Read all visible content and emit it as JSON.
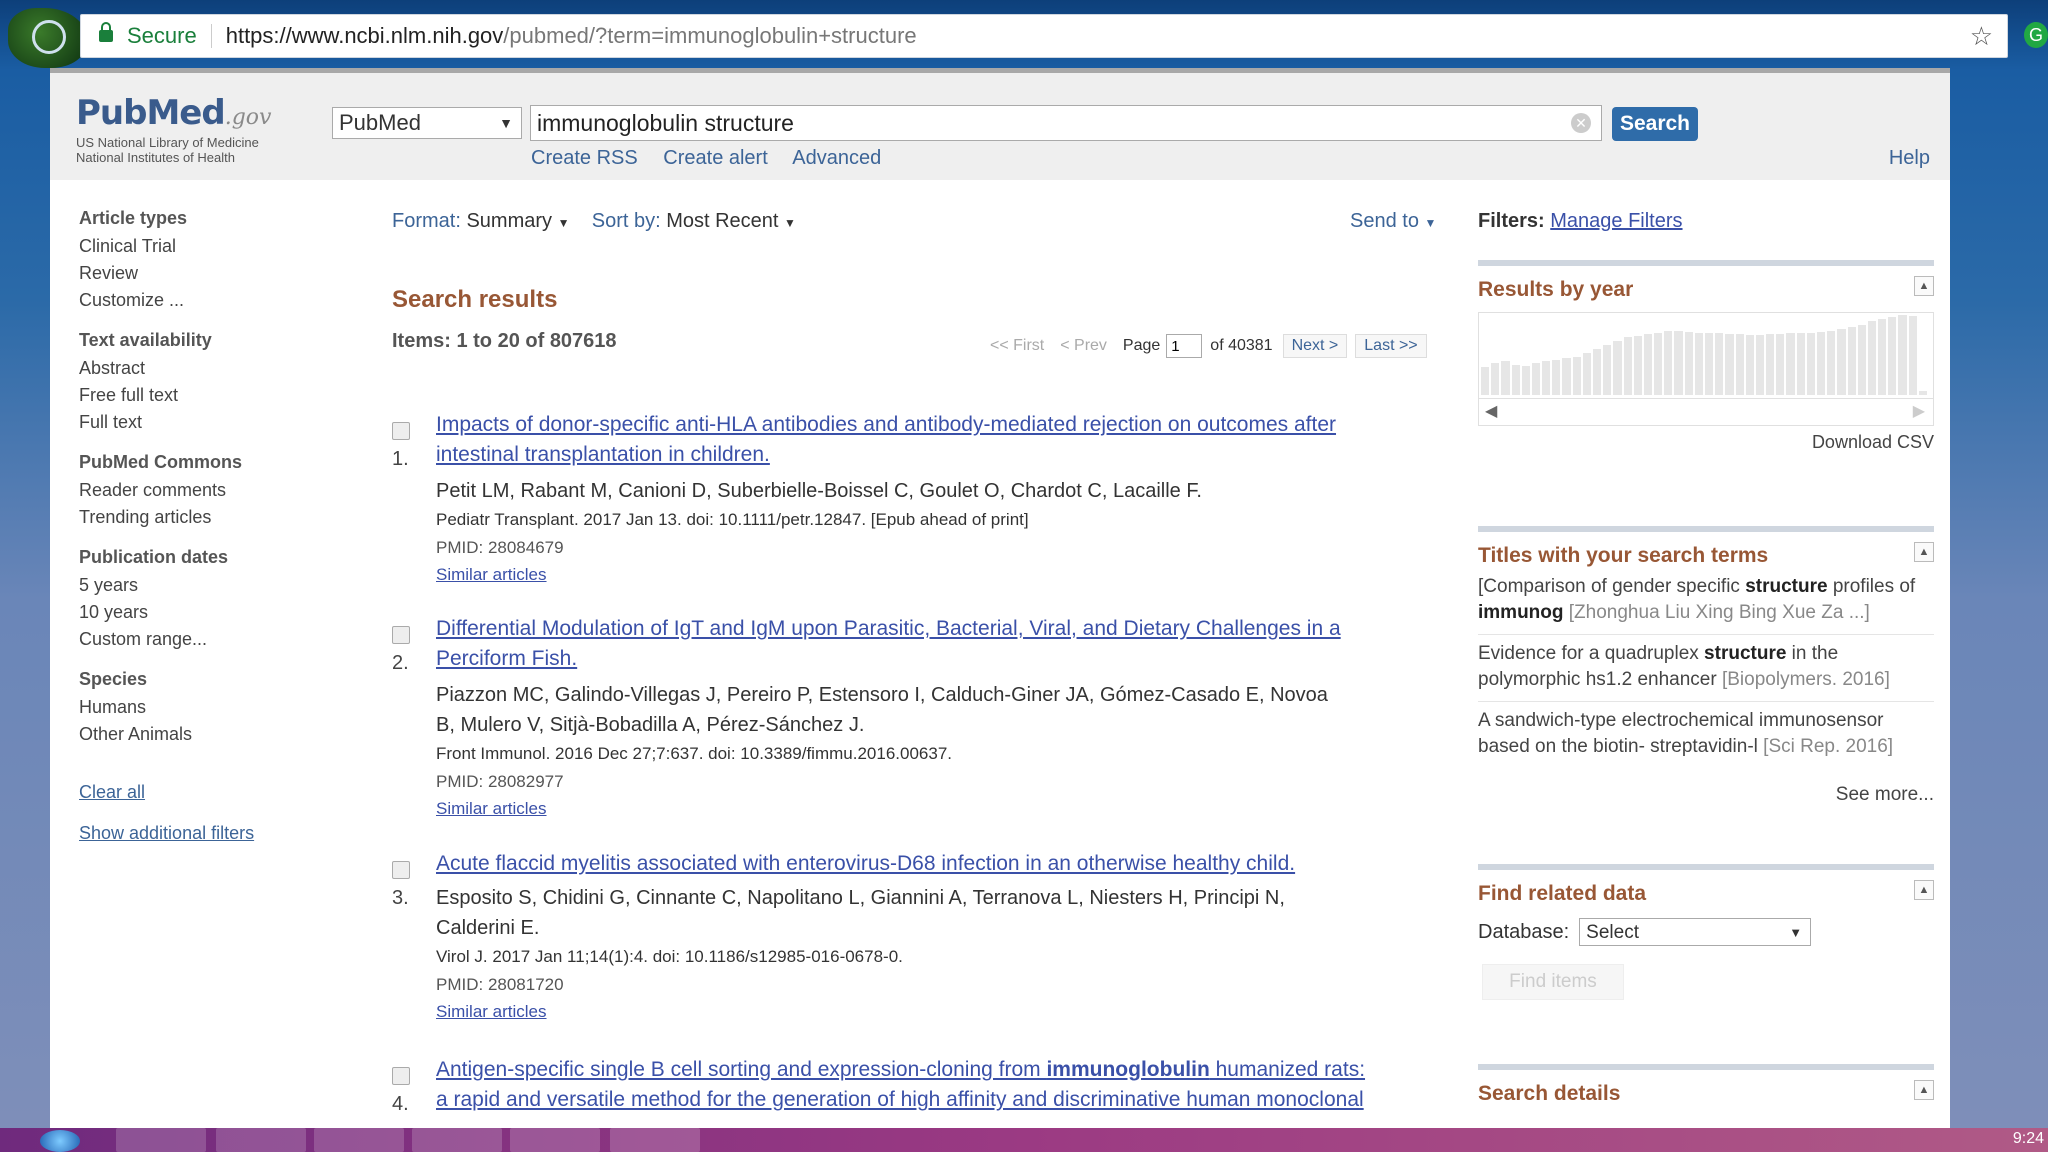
{
  "browser": {
    "secure_label": "Secure",
    "url_host": "https://www.ncbi.nlm.nih.gov",
    "url_path": "/pubmed/?term=immunoglobulin+structure"
  },
  "header": {
    "logo_main": "PubMed",
    "logo_gov": ".gov",
    "logo_sub1": "US National Library of Medicine",
    "logo_sub2": "National Institutes of Health",
    "db_selected": "PubMed",
    "search_value": "immunoglobulin structure",
    "search_button": "Search",
    "links": [
      "Create RSS",
      "Create alert",
      "Advanced"
    ],
    "help": "Help"
  },
  "sidebar": {
    "groups": [
      {
        "head": "Article types",
        "items": [
          "Clinical Trial",
          "Review",
          "Customize ..."
        ]
      },
      {
        "head": "Text availability",
        "items": [
          "Abstract",
          "Free full text",
          "Full text"
        ]
      },
      {
        "head": "PubMed Commons",
        "items": [
          "Reader comments",
          "Trending articles"
        ]
      },
      {
        "head": "Publication dates",
        "items": [
          "5 years",
          "10 years",
          "Custom range..."
        ]
      },
      {
        "head": "Species",
        "items": [
          "Humans",
          "Other Animals"
        ]
      }
    ],
    "clear_all": "Clear all",
    "show_filters": "Show additional filters"
  },
  "toolbar": {
    "format_label": "Format:",
    "format_value": "Summary",
    "sort_label": "Sort by:",
    "sort_value": "Most Recent",
    "send_to": "Send to"
  },
  "results": {
    "title": "Search results",
    "count": "Items: 1 to 20 of 807618",
    "pager": {
      "first": "<< First",
      "prev": "< Prev",
      "page_label": "Page",
      "page_value": "1",
      "of": "of 40381",
      "next": "Next >",
      "last": "Last >>"
    },
    "items": [
      {
        "num": "1.",
        "title_line1": "Impacts of donor-specific anti-HLA antibodies and antibody-mediated rejection on outcomes after",
        "title_line2": "intestinal transplantation in children.",
        "authors": "Petit LM, Rabant M, Canioni D, Suberbielle-Boissel C, Goulet O, Chardot C, Lacaille F.",
        "journal": "Pediatr Transplant. 2017 Jan 13. doi: 10.1111/petr.12847. [Epub ahead of print]",
        "pmid": "PMID: 28084679",
        "similar": "Similar articles"
      },
      {
        "num": "2.",
        "title_line1": "Differential Modulation of IgT and IgM upon Parasitic, Bacterial, Viral, and Dietary Challenges in a",
        "title_line2": "Perciform Fish.",
        "authors_line1": "Piazzon MC, Galindo-Villegas J, Pereiro P, Estensoro I, Calduch-Giner JA, Gómez-Casado E, Novoa",
        "authors_line2": "B, Mulero V, Sitjà-Bobadilla A, Pérez-Sánchez J.",
        "journal": "Front Immunol. 2016 Dec 27;7:637. doi: 10.3389/fimmu.2016.00637.",
        "pmid": "PMID: 28082977",
        "similar": "Similar articles"
      },
      {
        "num": "3.",
        "title_line1": "Acute flaccid myelitis associated with enterovirus-D68 infection in an otherwise healthy child.",
        "authors_line1": "Esposito S, Chidini G, Cinnante C, Napolitano L, Giannini A, Terranova L, Niesters H, Principi N,",
        "authors_line2": "Calderini E.",
        "journal": "Virol J. 2017 Jan 11;14(1):4. doi: 10.1186/s12985-016-0678-0.",
        "pmid": "PMID: 28081720",
        "similar": "Similar articles"
      },
      {
        "num": "4.",
        "title_line1_pre": "Antigen-specific single B cell sorting and expression-cloning from ",
        "title_line1_bold": "immunoglobulin",
        "title_line1_post": " humanized rats:",
        "title_line2": "a rapid and versatile method for the generation of high affinity and discriminative human monoclonal"
      }
    ]
  },
  "right": {
    "filters_label": "Filters:",
    "manage_filters": "Manage Filters",
    "results_by_year": "Results by year",
    "year_bars": [
      0.35,
      0.4,
      0.42,
      0.38,
      0.36,
      0.4,
      0.42,
      0.44,
      0.46,
      0.48,
      0.52,
      0.58,
      0.63,
      0.68,
      0.72,
      0.74,
      0.76,
      0.78,
      0.8,
      0.8,
      0.79,
      0.78,
      0.78,
      0.77,
      0.76,
      0.76,
      0.75,
      0.75,
      0.76,
      0.76,
      0.77,
      0.78,
      0.78,
      0.79,
      0.8,
      0.82,
      0.85,
      0.88,
      0.92,
      0.95,
      0.98,
      1.0,
      0.99,
      0.05
    ],
    "download_csv": "Download CSV",
    "titles_heading": "Titles with your search terms",
    "titles": [
      {
        "pre": "[Comparison of gender specific ",
        "b1": "structure",
        "mid": " profiles of ",
        "b2": "immunog",
        "jr": " [Zhonghua Liu Xing Bing Xue Za ...]"
      },
      {
        "pre": "Evidence for a quadruplex ",
        "b1": "structure",
        "mid": " in the polymorphic hs1.2 enhancer ",
        "b2": "",
        "jr": "[Biopolymers. 2016]"
      },
      {
        "pre": "A sandwich-type electrochemical immunosensor based on the biotin- streptavidin-l ",
        "b1": "",
        "mid": "",
        "b2": "",
        "jr": "[Sci Rep. 2016]"
      }
    ],
    "see_more": "See more...",
    "related_heading": "Find related data",
    "database_label": "Database:",
    "database_value": "Select",
    "find_items": "Find items",
    "search_details": "Search details"
  },
  "taskbar": {
    "time": "9:24"
  }
}
